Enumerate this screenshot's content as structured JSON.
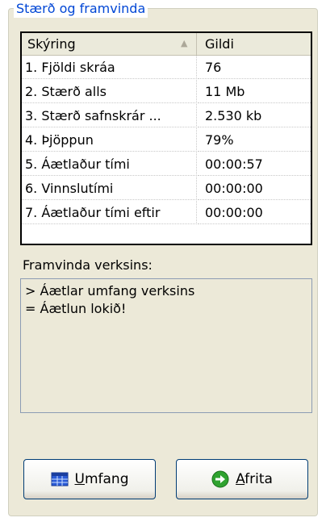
{
  "group": {
    "title": "Stærð og framvinda"
  },
  "table": {
    "headers": {
      "col1": "Skýring",
      "col2": "Gildi"
    },
    "rows": [
      {
        "label": "1. Fjöldi skráa",
        "value": "76"
      },
      {
        "label": "2. Stærð alls",
        "value": "11 Mb"
      },
      {
        "label": "3. Stærð safnskrár ...",
        "value": "2.530 kb"
      },
      {
        "label": "4. Þjöppun",
        "value": "79%"
      },
      {
        "label": "5. Áætlaður tími",
        "value": "00:00:57"
      },
      {
        "label": "6. Vinnslutími",
        "value": "00:00:00"
      },
      {
        "label": "7. Áætlaður tími eftir",
        "value": "00:00:00"
      }
    ]
  },
  "progress": {
    "label": "Framvinda verksins:",
    "lines": [
      "> Áætlar umfang verksins",
      "= Áætlun lokið!"
    ]
  },
  "buttons": {
    "left_label": "Umfang",
    "right_label": "Afrita"
  },
  "colors": {
    "title": "#0046d5",
    "panel": "#ece9d8",
    "button_border": "#003c74"
  },
  "icons": {
    "left_button": "table-grid-icon",
    "right_button": "green-arrow-icon",
    "sort": "sort-ascending-icon"
  }
}
